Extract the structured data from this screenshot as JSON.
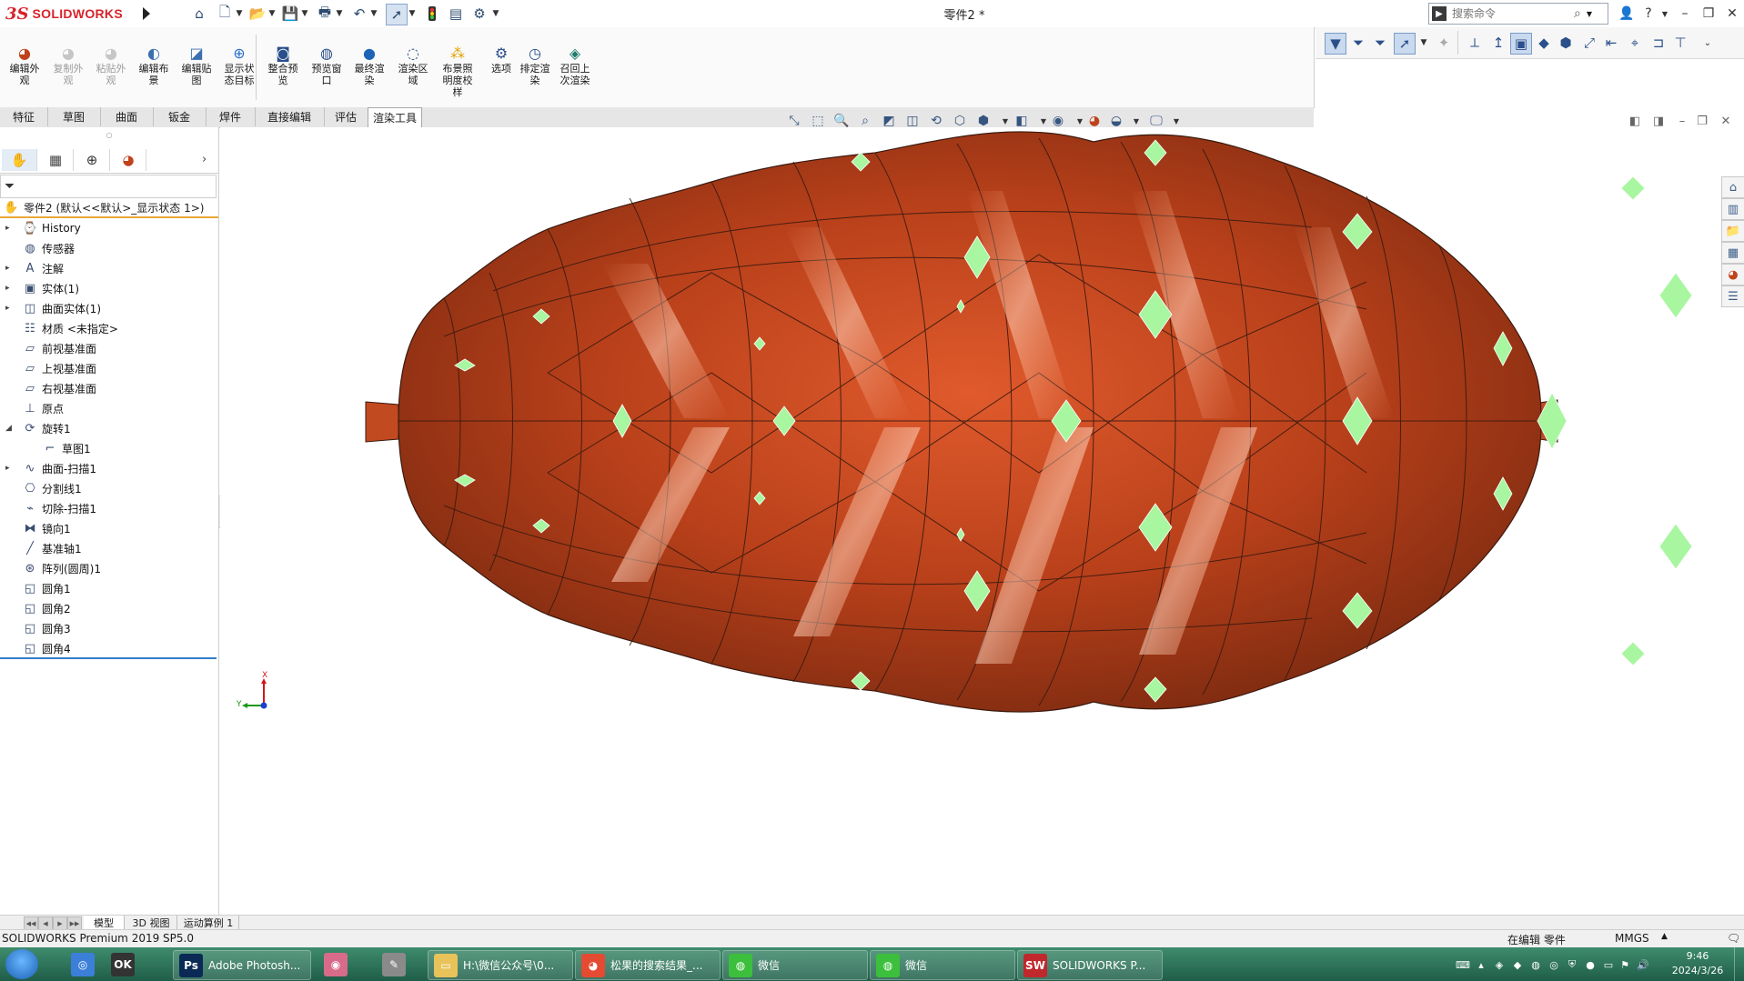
{
  "app": {
    "brand_prefix": "3S",
    "brand_name": "SOLIDWORKS",
    "document_title": "零件2 *",
    "search_placeholder": "搜索命令"
  },
  "command_manager": {
    "buttons": [
      {
        "label": "编辑外\n观",
        "enabled": true,
        "icon": "edit-appearance-icon"
      },
      {
        "label": "复制外\n观",
        "enabled": false,
        "icon": "copy-appearance-icon"
      },
      {
        "label": "粘贴外\n观",
        "enabled": false,
        "icon": "paste-appearance-icon"
      },
      {
        "label": "编辑布\n景",
        "enabled": true,
        "icon": "edit-scene-icon"
      },
      {
        "label": "编辑贴\n图",
        "enabled": true,
        "icon": "edit-decal-icon"
      },
      {
        "label": "显示状\n态目标",
        "enabled": true,
        "icon": "display-state-target-icon"
      },
      {
        "label": "整合预\n览",
        "enabled": true,
        "icon": "integrated-preview-icon"
      },
      {
        "label": "预览窗\n口",
        "enabled": true,
        "icon": "preview-window-icon"
      },
      {
        "label": "最终渲\n染",
        "enabled": true,
        "icon": "final-render-icon"
      },
      {
        "label": "渲染区\n域",
        "enabled": true,
        "icon": "render-region-icon"
      },
      {
        "label": "布景照\n明度校\n样",
        "enabled": true,
        "icon": "scene-illumination-proof-icon"
      },
      {
        "label": "选项",
        "enabled": true,
        "icon": "options-icon"
      },
      {
        "label": "排定渲\n染",
        "enabled": true,
        "icon": "schedule-render-icon"
      },
      {
        "label": "召回上\n次渲染",
        "enabled": true,
        "icon": "recall-last-render-icon"
      }
    ]
  },
  "tabs": [
    {
      "label": "特征",
      "active": false
    },
    {
      "label": "草图",
      "active": false
    },
    {
      "label": "曲面",
      "active": false
    },
    {
      "label": "钣金",
      "active": false
    },
    {
      "label": "焊件",
      "active": false
    },
    {
      "label": "直接编辑",
      "active": false
    },
    {
      "label": "评估",
      "active": false
    },
    {
      "label": "渲染工具",
      "active": true
    }
  ],
  "feature_tree": {
    "root": "零件2 (默认<<默认>_显示状态 1>)",
    "items": [
      {
        "label": "History",
        "expandable": true,
        "icon": "history-icon"
      },
      {
        "label": "传感器",
        "expandable": false,
        "icon": "sensor-icon"
      },
      {
        "label": "注解",
        "expandable": true,
        "icon": "annotation-icon"
      },
      {
        "label": "实体(1)",
        "expandable": true,
        "icon": "solid-body-icon"
      },
      {
        "label": "曲面实体(1)",
        "expandable": true,
        "icon": "surface-body-icon"
      },
      {
        "label": "材质 <未指定>",
        "expandable": false,
        "icon": "material-icon"
      },
      {
        "label": "前视基准面",
        "expandable": false,
        "icon": "plane-icon"
      },
      {
        "label": "上视基准面",
        "expandable": false,
        "icon": "plane-icon"
      },
      {
        "label": "右视基准面",
        "expandable": false,
        "icon": "plane-icon"
      },
      {
        "label": "原点",
        "expandable": false,
        "icon": "origin-icon"
      },
      {
        "label": "旋转1",
        "expandable": true,
        "expanded": true,
        "icon": "revolve-icon"
      },
      {
        "label": "草图1",
        "expandable": false,
        "child": true,
        "icon": "sketch-icon"
      },
      {
        "label": "曲面-扫描1",
        "expandable": true,
        "icon": "surface-sweep-icon"
      },
      {
        "label": "分割线1",
        "expandable": false,
        "icon": "split-line-icon"
      },
      {
        "label": "切除-扫描1",
        "expandable": false,
        "icon": "cut-sweep-icon"
      },
      {
        "label": "镜向1",
        "expandable": false,
        "icon": "mirror-icon"
      },
      {
        "label": "基准轴1",
        "expandable": false,
        "icon": "axis-icon"
      },
      {
        "label": "阵列(圆周)1",
        "expandable": false,
        "icon": "circular-pattern-icon"
      },
      {
        "label": "圆角1",
        "expandable": false,
        "icon": "fillet-icon"
      },
      {
        "label": "圆角2",
        "expandable": false,
        "icon": "fillet-icon"
      },
      {
        "label": "圆角3",
        "expandable": false,
        "icon": "fillet-icon"
      },
      {
        "label": "圆角4",
        "expandable": false,
        "icon": "fillet-icon"
      }
    ]
  },
  "viewport": {
    "model_color": "#c0421a",
    "highlight_color": "#8ef08e",
    "triad": {
      "x": "X",
      "y": "Y"
    }
  },
  "bottom_tabs": [
    {
      "label": "模型",
      "active": true
    },
    {
      "label": "3D 视图",
      "active": false
    },
    {
      "label": "运动算例 1",
      "active": false
    }
  ],
  "status": {
    "left": "SOLIDWORKS Premium 2019 SP5.0",
    "mode": "在编辑 零件",
    "units": "MMGS"
  },
  "taskbar": {
    "items": [
      {
        "label": "",
        "icon": "windows-media-icon"
      },
      {
        "label": "",
        "icon": "ok-app-icon"
      },
      {
        "label": "Adobe Photosh...",
        "icon": "photoshop-icon"
      },
      {
        "label": "",
        "icon": "paint-icon"
      },
      {
        "label": "",
        "icon": "pen-tool-icon"
      },
      {
        "label": "H:\\微信公众号\\0...",
        "icon": "folder-icon"
      },
      {
        "label": "松果的搜索结果_...",
        "icon": "chrome-icon"
      },
      {
        "label": "微信",
        "icon": "wechat-icon"
      },
      {
        "label": "微信",
        "icon": "wechat-icon"
      },
      {
        "label": "SOLIDWORKS P...",
        "icon": "solidworks-icon"
      }
    ],
    "clock_time": "9:46",
    "clock_date": "2024/3/26"
  }
}
